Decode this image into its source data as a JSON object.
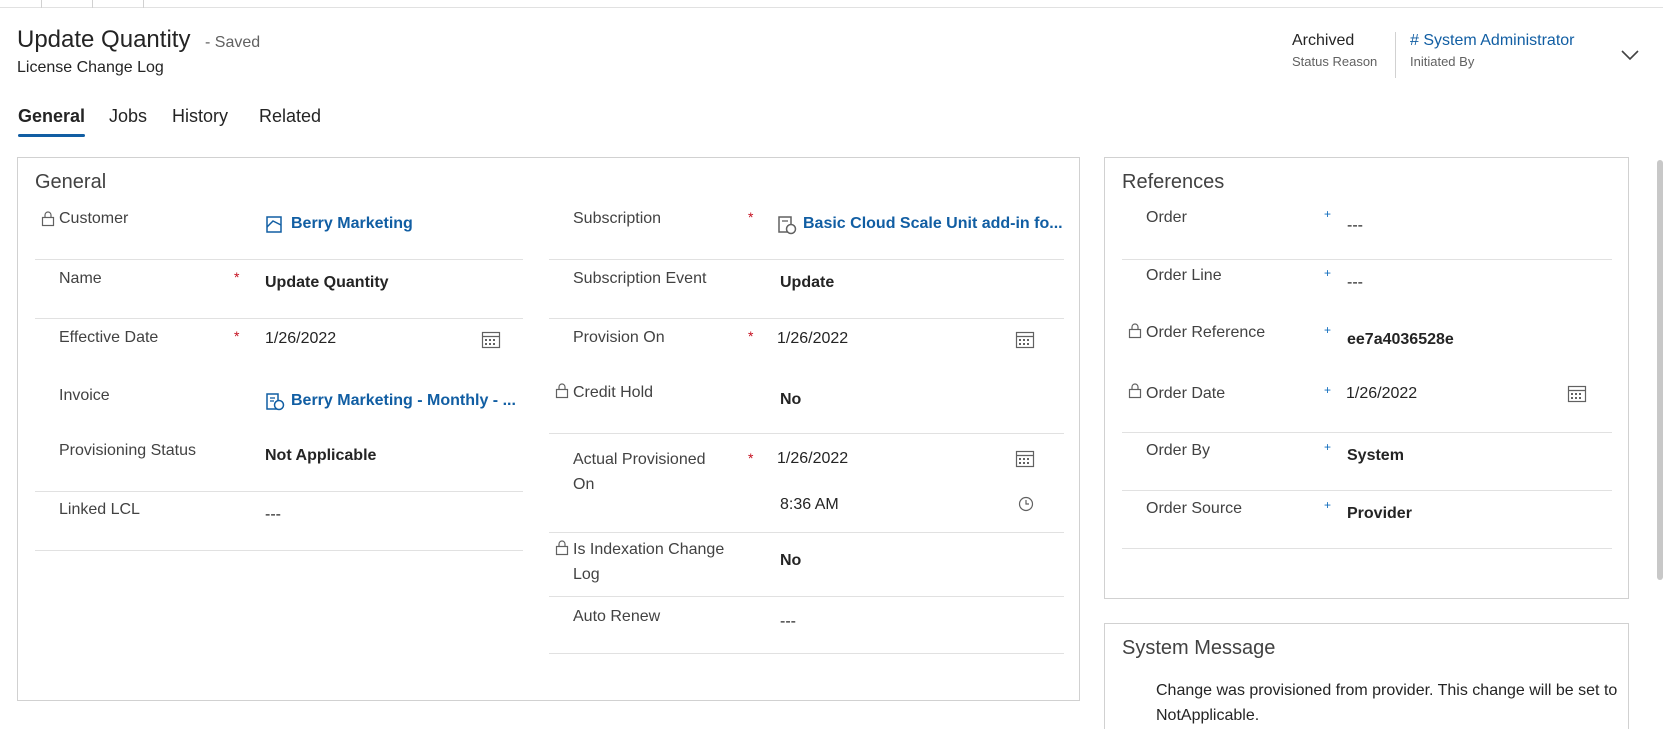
{
  "header": {
    "title": "Update Quantity",
    "saved_status": "- Saved",
    "entity": "License Change Log",
    "status_reason_value": "Archived",
    "status_reason_label": "Status Reason",
    "initiated_by_value": "# System Administrator",
    "initiated_by_label": "Initiated By"
  },
  "tabs": [
    {
      "label": "General"
    },
    {
      "label": "Jobs"
    },
    {
      "label": "History"
    },
    {
      "label": "Related"
    }
  ],
  "general": {
    "title": "General",
    "left": [
      {
        "label": "Customer",
        "value": "Berry Marketing"
      },
      {
        "label": "Name",
        "required": "*",
        "value": "Update Quantity"
      },
      {
        "label": "Effective Date",
        "required": "*",
        "value": "1/26/2022"
      },
      {
        "label": "Invoice",
        "value": "Berry Marketing - Monthly - ..."
      },
      {
        "label": "Provisioning Status",
        "value": "Not Applicable"
      },
      {
        "label": "Linked LCL",
        "value": "---"
      }
    ],
    "right": [
      {
        "label": "Subscription",
        "required": "*",
        "value": "Basic Cloud Scale Unit add-in fo..."
      },
      {
        "label": "Subscription Event",
        "value": "Update"
      },
      {
        "label": "Provision On",
        "required": "*",
        "value": "1/26/2022"
      },
      {
        "label": "Credit Hold",
        "value": "No"
      },
      {
        "label_line1": "Actual Provisioned",
        "label_line2": "On",
        "required": "*",
        "value": "1/26/2022",
        "time": "8:36 AM"
      },
      {
        "label_line1": "Is Indexation Change",
        "label_line2": "Log",
        "value": "No"
      },
      {
        "label": "Auto Renew",
        "value": "---"
      }
    ]
  },
  "references": {
    "title": "References",
    "rows": [
      {
        "label": "Order",
        "required": "+",
        "value": "---"
      },
      {
        "label": "Order Line",
        "required": "+",
        "value": "---"
      },
      {
        "label": "Order Reference",
        "required": "+",
        "value": "ee7a4036528e"
      },
      {
        "label": "Order Date",
        "required": "+",
        "value": "1/26/2022"
      },
      {
        "label": "Order By",
        "required": "+",
        "value": "System"
      },
      {
        "label": "Order Source",
        "required": "+",
        "value": "Provider"
      }
    ]
  },
  "system_message": {
    "title": "System Message",
    "text": "Change was provisioned from provider. This change will be set to NotApplicable."
  },
  "colors": {
    "accent": "#115ea3",
    "required": "#c50f1f",
    "border": "#d1d1d1"
  },
  "icons": [
    "lock-icon",
    "calendar-icon",
    "clock-icon",
    "chevron-down-icon",
    "customer-record-icon",
    "invoice-record-icon",
    "subscription-record-icon"
  ]
}
